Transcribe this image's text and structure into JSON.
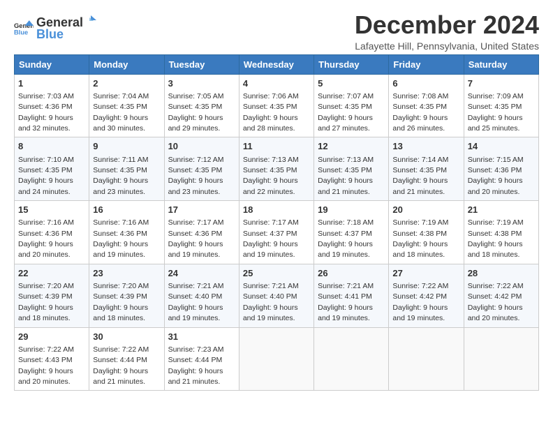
{
  "logo": {
    "text_general": "General",
    "text_blue": "Blue"
  },
  "header": {
    "month": "December 2024",
    "location": "Lafayette Hill, Pennsylvania, United States"
  },
  "weekdays": [
    "Sunday",
    "Monday",
    "Tuesday",
    "Wednesday",
    "Thursday",
    "Friday",
    "Saturday"
  ],
  "weeks": [
    [
      {
        "day": "1",
        "sunrise": "7:03 AM",
        "sunset": "4:36 PM",
        "daylight": "9 hours and 32 minutes."
      },
      {
        "day": "2",
        "sunrise": "7:04 AM",
        "sunset": "4:35 PM",
        "daylight": "9 hours and 30 minutes."
      },
      {
        "day": "3",
        "sunrise": "7:05 AM",
        "sunset": "4:35 PM",
        "daylight": "9 hours and 29 minutes."
      },
      {
        "day": "4",
        "sunrise": "7:06 AM",
        "sunset": "4:35 PM",
        "daylight": "9 hours and 28 minutes."
      },
      {
        "day": "5",
        "sunrise": "7:07 AM",
        "sunset": "4:35 PM",
        "daylight": "9 hours and 27 minutes."
      },
      {
        "day": "6",
        "sunrise": "7:08 AM",
        "sunset": "4:35 PM",
        "daylight": "9 hours and 26 minutes."
      },
      {
        "day": "7",
        "sunrise": "7:09 AM",
        "sunset": "4:35 PM",
        "daylight": "9 hours and 25 minutes."
      }
    ],
    [
      {
        "day": "8",
        "sunrise": "7:10 AM",
        "sunset": "4:35 PM",
        "daylight": "9 hours and 24 minutes."
      },
      {
        "day": "9",
        "sunrise": "7:11 AM",
        "sunset": "4:35 PM",
        "daylight": "9 hours and 23 minutes."
      },
      {
        "day": "10",
        "sunrise": "7:12 AM",
        "sunset": "4:35 PM",
        "daylight": "9 hours and 23 minutes."
      },
      {
        "day": "11",
        "sunrise": "7:13 AM",
        "sunset": "4:35 PM",
        "daylight": "9 hours and 22 minutes."
      },
      {
        "day": "12",
        "sunrise": "7:13 AM",
        "sunset": "4:35 PM",
        "daylight": "9 hours and 21 minutes."
      },
      {
        "day": "13",
        "sunrise": "7:14 AM",
        "sunset": "4:35 PM",
        "daylight": "9 hours and 21 minutes."
      },
      {
        "day": "14",
        "sunrise": "7:15 AM",
        "sunset": "4:36 PM",
        "daylight": "9 hours and 20 minutes."
      }
    ],
    [
      {
        "day": "15",
        "sunrise": "7:16 AM",
        "sunset": "4:36 PM",
        "daylight": "9 hours and 20 minutes."
      },
      {
        "day": "16",
        "sunrise": "7:16 AM",
        "sunset": "4:36 PM",
        "daylight": "9 hours and 19 minutes."
      },
      {
        "day": "17",
        "sunrise": "7:17 AM",
        "sunset": "4:36 PM",
        "daylight": "9 hours and 19 minutes."
      },
      {
        "day": "18",
        "sunrise": "7:17 AM",
        "sunset": "4:37 PM",
        "daylight": "9 hours and 19 minutes."
      },
      {
        "day": "19",
        "sunrise": "7:18 AM",
        "sunset": "4:37 PM",
        "daylight": "9 hours and 19 minutes."
      },
      {
        "day": "20",
        "sunrise": "7:19 AM",
        "sunset": "4:38 PM",
        "daylight": "9 hours and 18 minutes."
      },
      {
        "day": "21",
        "sunrise": "7:19 AM",
        "sunset": "4:38 PM",
        "daylight": "9 hours and 18 minutes."
      }
    ],
    [
      {
        "day": "22",
        "sunrise": "7:20 AM",
        "sunset": "4:39 PM",
        "daylight": "9 hours and 18 minutes."
      },
      {
        "day": "23",
        "sunrise": "7:20 AM",
        "sunset": "4:39 PM",
        "daylight": "9 hours and 18 minutes."
      },
      {
        "day": "24",
        "sunrise": "7:21 AM",
        "sunset": "4:40 PM",
        "daylight": "9 hours and 19 minutes."
      },
      {
        "day": "25",
        "sunrise": "7:21 AM",
        "sunset": "4:40 PM",
        "daylight": "9 hours and 19 minutes."
      },
      {
        "day": "26",
        "sunrise": "7:21 AM",
        "sunset": "4:41 PM",
        "daylight": "9 hours and 19 minutes."
      },
      {
        "day": "27",
        "sunrise": "7:22 AM",
        "sunset": "4:42 PM",
        "daylight": "9 hours and 19 minutes."
      },
      {
        "day": "28",
        "sunrise": "7:22 AM",
        "sunset": "4:42 PM",
        "daylight": "9 hours and 20 minutes."
      }
    ],
    [
      {
        "day": "29",
        "sunrise": "7:22 AM",
        "sunset": "4:43 PM",
        "daylight": "9 hours and 20 minutes."
      },
      {
        "day": "30",
        "sunrise": "7:22 AM",
        "sunset": "4:44 PM",
        "daylight": "9 hours and 21 minutes."
      },
      {
        "day": "31",
        "sunrise": "7:23 AM",
        "sunset": "4:44 PM",
        "daylight": "9 hours and 21 minutes."
      },
      null,
      null,
      null,
      null
    ]
  ],
  "labels": {
    "sunrise": "Sunrise:",
    "sunset": "Sunset:",
    "daylight": "Daylight:"
  }
}
